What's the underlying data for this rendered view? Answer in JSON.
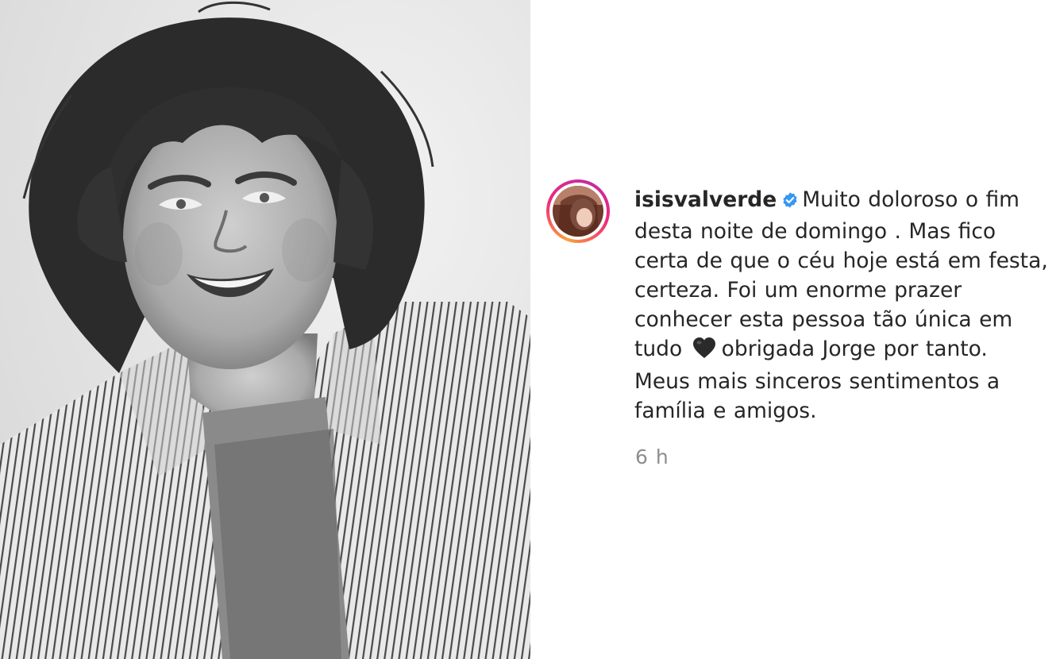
{
  "post": {
    "username": "isisvalverde",
    "caption_lines": [
      "Muito doloroso o fim",
      "desta noite de domingo . Mas fico",
      "certa de que o céu hoje está em festa,",
      "certeza. Foi um enorme prazer",
      "conhecer esta pessoa tão única em",
      "tudo",
      "obrigada Jorge por tanto.",
      "Meus mais sinceros sentimentos a",
      "família e amigos."
    ],
    "timestamp": "6 h"
  },
  "icons": {
    "verified": "verified-badge-icon",
    "heart": "black-heart-emoji"
  },
  "colors": {
    "verified_blue": "#3897f0",
    "text": "#262626",
    "muted": "#8e8e8e",
    "story_ring_start": "#f9a23a",
    "story_ring_end": "#c32aa3"
  }
}
